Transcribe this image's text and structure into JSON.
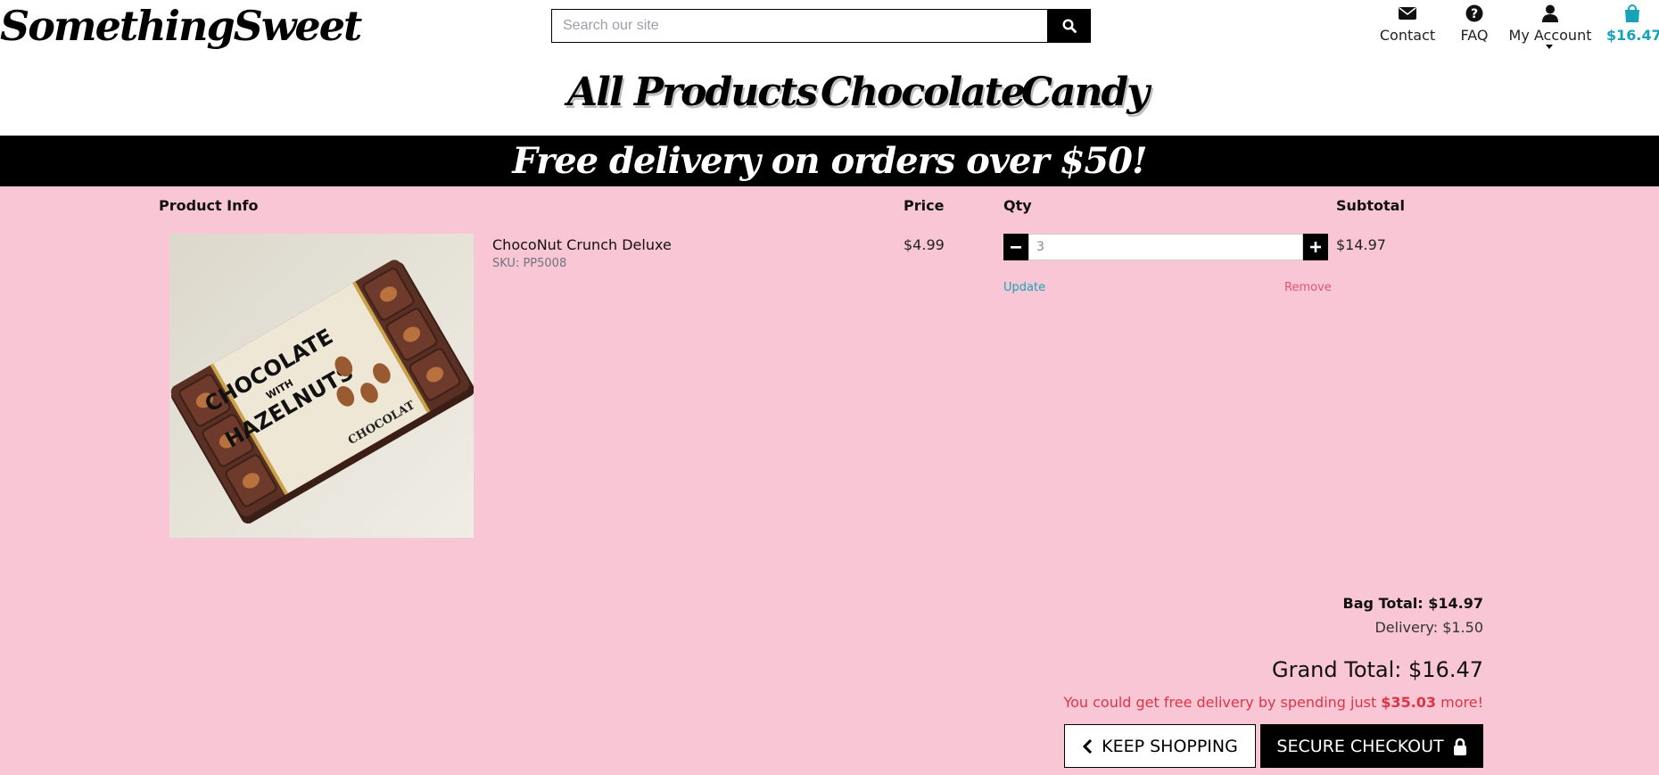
{
  "header": {
    "logo_text": "SomethingSweet",
    "search": {
      "placeholder": "Search our site",
      "value": ""
    },
    "nav_icons": {
      "contact_label": "Contact",
      "faq_label": "FAQ",
      "account_label": "My Account",
      "bag_total": "$16.47"
    },
    "main_nav": [
      "All Products",
      "Chocolate",
      "Candy"
    ]
  },
  "banner": {
    "text": "Free delivery on orders over $50!"
  },
  "bag": {
    "columns": {
      "product": "Product Info",
      "price": "Price",
      "qty": "Qty",
      "subtotal": "Subtotal"
    },
    "items": [
      {
        "name": "ChocoNut Crunch Deluxe",
        "sku": "SKU: PP5008",
        "price": "$4.99",
        "qty": "3",
        "subtotal": "$14.97",
        "update_label": "Update",
        "remove_label": "Remove",
        "image_text": {
          "line1": "CHOCOLATE",
          "line2": "WITH",
          "line3": "HAZELNUTS",
          "line4": "CHOCOLAT"
        }
      }
    ],
    "totals": {
      "bag_total_label": "Bag Total: ",
      "bag_total_value": "$14.97",
      "delivery": "Delivery: $1.50",
      "grand_total": "Grand Total: $16.47",
      "free_note_prefix": "You could get free delivery by spending just ",
      "free_note_amount": "$35.03",
      "free_note_suffix": " more!"
    },
    "buttons": {
      "keep_shopping": "KEEP SHOPPING",
      "checkout": "SECURE CHECKOUT"
    }
  },
  "colors": {
    "accent_teal": "#17a2b8",
    "page_pink": "#f9c6d6",
    "alert_red": "#dc3545"
  }
}
